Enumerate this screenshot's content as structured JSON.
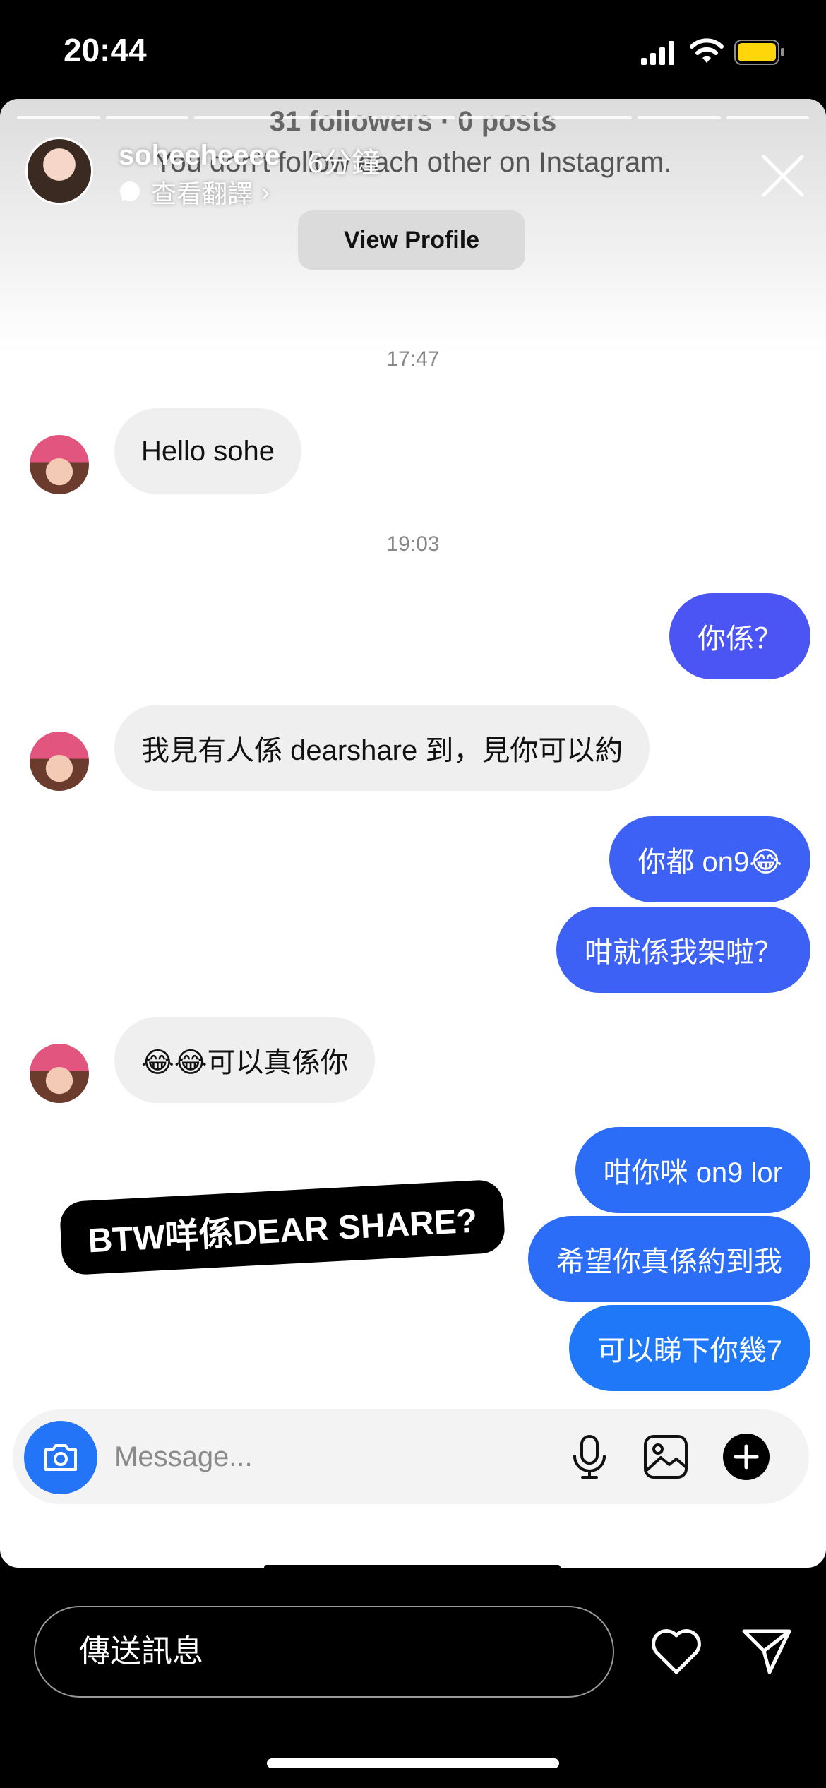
{
  "status_bar": {
    "time": "20:44",
    "signal_icon": "cellular-signal-icon",
    "wifi_icon": "wifi-icon",
    "battery_icon": "battery-icon",
    "battery_color": "#ffd60a"
  },
  "story": {
    "username": "soheeheeee",
    "time_ago": "6分鐘",
    "translate_label": "查看翻譯",
    "translate_chevron": "›",
    "progress_segments": 9,
    "close_icon": "close-icon"
  },
  "profile": {
    "followers_line": "31 followers · 0 posts",
    "mutual_line": "You don't follow each other on Instagram.",
    "view_profile_label": "View Profile"
  },
  "conversation": {
    "timestamps": [
      "17:47",
      "19:03"
    ],
    "incoming_color": "#efefef",
    "outgoing_colors": [
      "#4b55f3",
      "#3d60f5",
      "#2b6df6",
      "#1f78f7"
    ],
    "messages": [
      {
        "direction": "in",
        "text": "Hello sohe"
      },
      {
        "direction": "out",
        "text": "你係？"
      },
      {
        "direction": "in",
        "text": "我見有人係 dearshare 到，見你可以約"
      },
      {
        "direction": "out",
        "text": "你都 on9😂"
      },
      {
        "direction": "out",
        "text": "咁就係我架啦？"
      },
      {
        "direction": "in",
        "text": "😂😂可以真係你"
      },
      {
        "direction": "out",
        "text": "咁你咪 on9 lor"
      },
      {
        "direction": "out",
        "text": "希望你真係約到我"
      },
      {
        "direction": "out",
        "text": "可以睇下你幾7"
      }
    ]
  },
  "sticker": {
    "text": "BTW咩係DEAR SHARE?"
  },
  "composer": {
    "placeholder": "Message...",
    "camera_icon": "camera-icon",
    "mic_icon": "microphone-icon",
    "gallery_icon": "gallery-icon",
    "plus_icon": "plus-icon",
    "camera_color": "#2374f6"
  },
  "reply_bar": {
    "placeholder": "傳送訊息",
    "heart_icon": "heart-icon",
    "send_icon": "send-icon"
  }
}
